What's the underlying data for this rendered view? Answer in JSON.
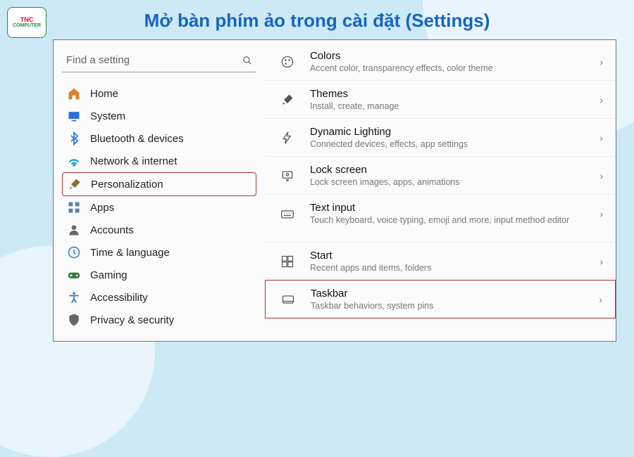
{
  "logo": {
    "line1": "TNC",
    "line2": "COMPUTER"
  },
  "title": "Mở bàn phím ảo trong cài đặt (Settings)",
  "search": {
    "placeholder": "Find a setting"
  },
  "sidebar": {
    "items": [
      {
        "label": "Home",
        "icon": "home-icon",
        "color": "#d9822b"
      },
      {
        "label": "System",
        "icon": "system-icon",
        "color": "#2a6fd6"
      },
      {
        "label": "Bluetooth & devices",
        "icon": "bluetooth-icon",
        "color": "#1a73e8"
      },
      {
        "label": "Network & internet",
        "icon": "wifi-icon",
        "color": "#00a3c4"
      },
      {
        "label": "Personalization",
        "icon": "brush-icon",
        "color": "#8a6d3b",
        "highlight": true
      },
      {
        "label": "Apps",
        "icon": "apps-icon",
        "color": "#5b7fa6"
      },
      {
        "label": "Accounts",
        "icon": "accounts-icon",
        "color": "#666"
      },
      {
        "label": "Time & language",
        "icon": "clock-icon",
        "color": "#3a88c9"
      },
      {
        "label": "Gaming",
        "icon": "gaming-icon",
        "color": "#3b7a3b"
      },
      {
        "label": "Accessibility",
        "icon": "accessibility-icon",
        "color": "#3a6fb0"
      },
      {
        "label": "Privacy & security",
        "icon": "shield-icon",
        "color": "#666"
      }
    ]
  },
  "content": {
    "rows": [
      {
        "title": "Colors",
        "sub": "Accent color, transparency effects, color theme",
        "icon": "palette-icon"
      },
      {
        "title": "Themes",
        "sub": "Install, create, manage",
        "icon": "brush-icon"
      },
      {
        "title": "Dynamic Lighting",
        "sub": "Connected devices, effects, app settings",
        "icon": "lighting-icon"
      },
      {
        "title": "Lock screen",
        "sub": "Lock screen images, apps, animations",
        "icon": "lock-icon"
      },
      {
        "title": "Text input",
        "sub": "Touch keyboard, voice typing, emoji and more, input method editor",
        "icon": "keyboard-icon"
      },
      {
        "title": "Start",
        "sub": "Recent apps and items, folders",
        "icon": "start-icon",
        "gap": true
      },
      {
        "title": "Taskbar",
        "sub": "Taskbar behaviors, system pins",
        "icon": "taskbar-icon",
        "highlight": true
      }
    ]
  }
}
